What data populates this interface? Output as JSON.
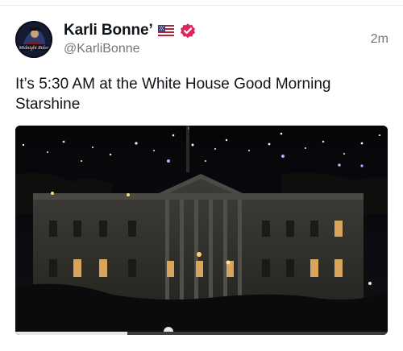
{
  "post": {
    "display_name": "Karli Bonne’",
    "handle": "@KarliBonne",
    "timestamp": "2m",
    "text": "It’s 5:30 AM at the White House Good Morning Starshine",
    "flag_icon": "us-flag-icon",
    "verified_icon": "verified-badge-icon",
    "verified_color": "#e0245e"
  },
  "avatar": {
    "logo_text": "Midnight Rider"
  },
  "media": {
    "type": "video",
    "progress_fraction": 0.3
  }
}
